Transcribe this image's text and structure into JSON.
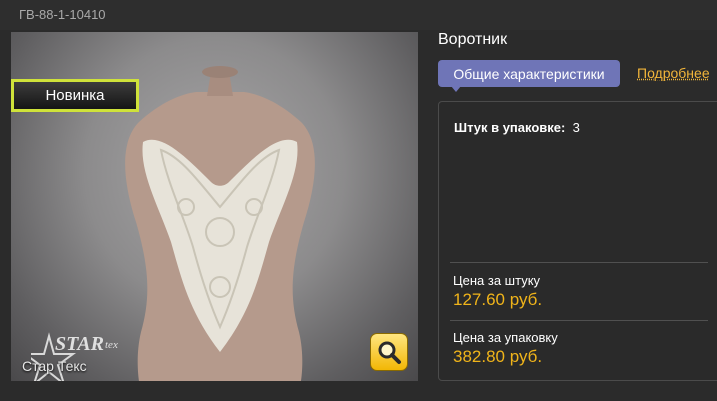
{
  "product": {
    "sku": "ГВ-88-1-10410",
    "title": "Воротник",
    "badge": "Новинка",
    "logo_text": "Стар Текс"
  },
  "tabs": [
    {
      "label": "Общие характеристики",
      "active": true
    },
    {
      "label": "Подробнее",
      "active": false
    }
  ],
  "specs": {
    "pack_label": "Штук в упаковке:",
    "pack_value": "3"
  },
  "prices": {
    "unit_label": "Цена за штуку",
    "unit_value": "127.60 руб.",
    "pack_label": "Цена за упаковку",
    "pack_value": "382.80 руб."
  },
  "colors": {
    "accent_price": "#f0b41a",
    "tab_active": "#6f75b7",
    "badge_border": "#cfe23a"
  },
  "icons": {
    "zoom": "magnifier-icon",
    "logo": "star-tex-logo"
  }
}
